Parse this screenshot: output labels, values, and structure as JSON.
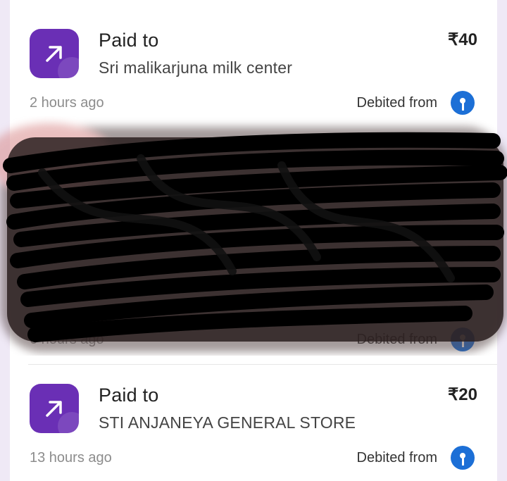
{
  "colors": {
    "icon_bg": "#6a2fb5",
    "bank_icon": "#1c6fd6",
    "page_bg": "#efe9f6"
  },
  "transactions": [
    {
      "title": "Paid to",
      "payee": "Sri malikarjuna milk center",
      "amount": "₹40",
      "time": "2 hours ago",
      "debit_label": "Debited from",
      "icon": "arrow-up-right-icon",
      "bank_icon": "bank-icon"
    },
    {
      "time": "6 hours ago",
      "debit_label": "Debited from",
      "icon": "arrow-up-right-icon",
      "bank_icon": "bank-icon",
      "redacted": true
    },
    {
      "title": "Paid to",
      "payee": "STI ANJANEYA GENERAL STORE",
      "amount": "₹20",
      "time": "13 hours ago",
      "debit_label": "Debited from",
      "icon": "arrow-up-right-icon",
      "bank_icon": "bank-icon"
    }
  ]
}
